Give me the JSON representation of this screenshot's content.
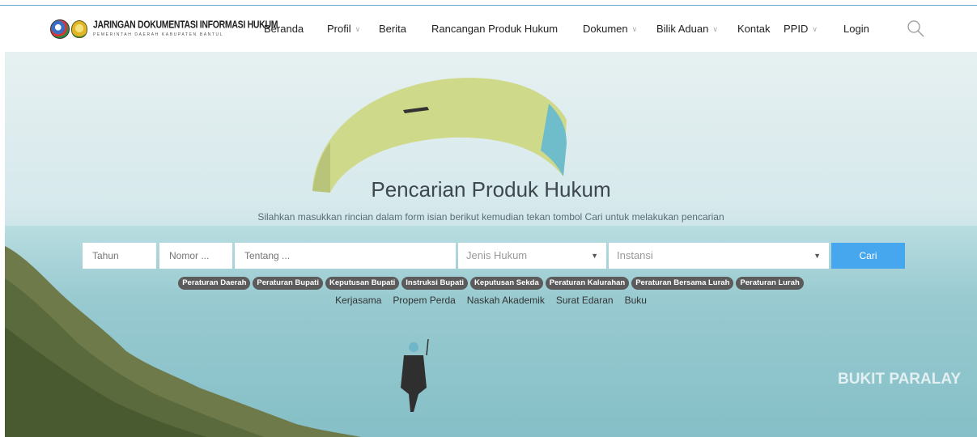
{
  "header": {
    "logo_title": "JARINGAN DOKUMENTASI INFORMASI HUKUM",
    "logo_subtitle": "PEMERINTAH DAERAH KABUPATEN BANTUL",
    "nav": [
      {
        "label": "Beranda"
      },
      {
        "label": "Profil",
        "dropdown": true
      },
      {
        "label": "Berita"
      },
      {
        "label": "Rancangan Produk Hukum"
      },
      {
        "label": "Dokumen",
        "dropdown": true
      },
      {
        "label": "Bilik Aduan",
        "dropdown": true
      },
      {
        "label": "Kontak"
      },
      {
        "label": "PPID",
        "dropdown": true
      },
      {
        "label": "Login"
      }
    ],
    "dropdown_glyph": "∨",
    "search_icon": "search-icon"
  },
  "hero": {
    "title": "Pencarian Produk Hukum",
    "subtitle": "Silahkan masukkan rincian dalam form isian berikut kemudian tekan tombol Cari untuk melakukan pencarian",
    "form": {
      "tahun_placeholder": "Tahun",
      "nomor_placeholder": "Nomor ...",
      "tentang_placeholder": "Tentang ...",
      "jenis_hukum": "Jenis Hukum",
      "instansi": "Instansi",
      "caret": "▼",
      "submit": "Cari",
      "submit_color": "#46a6ee"
    },
    "tags": [
      "Peraturan Daerah",
      "Peraturan Bupati",
      "Keputusan Bupati",
      "Instruksi Bupati",
      "Keputusan Sekda",
      "Peraturan Kalurahan",
      "Peraturan Bersama Lurah",
      "Peraturan Lurah"
    ],
    "links": [
      "Kerjasama",
      "Propem Perda",
      "Naskah Akademik",
      "Surat Edaran",
      "Buku"
    ],
    "caption": "BUKIT PARALAY"
  }
}
